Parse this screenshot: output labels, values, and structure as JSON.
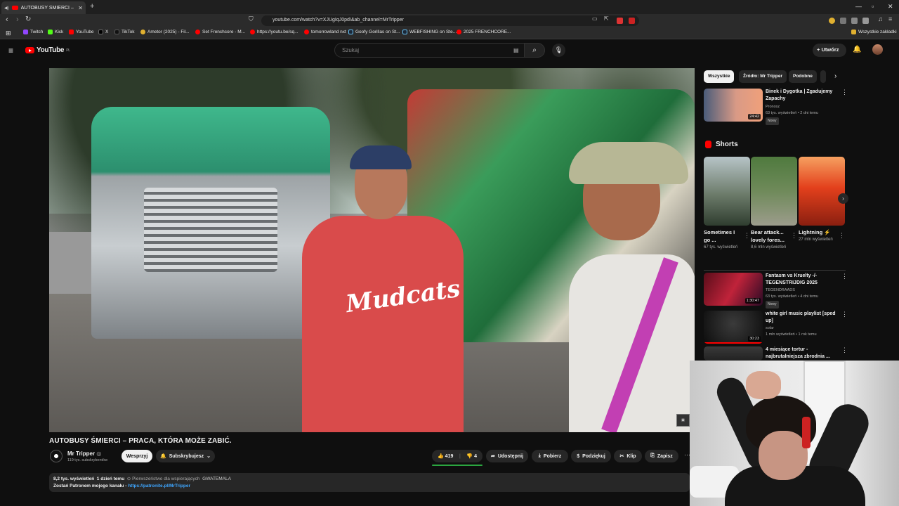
{
  "browser": {
    "tab_title": "AUTOBUSY ŚMIERCI – PRACA",
    "url": "youtube.com/watch?v=XJUgIqJ0pdI&ab_channel=MrTripper",
    "all_bookmarks": "Wszystkie zakładki",
    "bookmarks": [
      {
        "label": "Twitch",
        "color": "#9146ff"
      },
      {
        "label": "Kick",
        "color": "#53fc18"
      },
      {
        "label": "YouTube",
        "color": "#ff0000"
      },
      {
        "label": "X",
        "color": "#000000"
      },
      {
        "label": "TikTok",
        "color": "#111111"
      },
      {
        "label": "Ametor (2025) - Fil...",
        "color": "#e0b030"
      },
      {
        "label": "Set Frenchcore - M...",
        "color": "#ff0000"
      },
      {
        "label": "https://youtu.be/sq...",
        "color": "#ff0000"
      },
      {
        "label": "tomorrowland nxt",
        "color": "#ff0000"
      },
      {
        "label": "Goofy Gorillas on St...",
        "color": "#1b2838"
      },
      {
        "label": "WEBFISHING on Ste...",
        "color": "#1b2838"
      },
      {
        "label": "2025 FRENCHCORE...",
        "color": "#ff0000"
      }
    ]
  },
  "youtube": {
    "logo_text": "YouTube",
    "logo_region": "PL",
    "search_placeholder": "Szukaj",
    "create_label": "Utwórz"
  },
  "video": {
    "title": "AUTOBUSY ŚMIERCI – PRACA, KTÓRA MOŻE ZABIĆ.",
    "shirt_text": "Mudcats",
    "channel_name": "Mr Tripper",
    "channel_subs": "119 tys. subskrybentów",
    "support_label": "Wesprzyj",
    "subscribe_label": "Subskrybujesz",
    "likes": "419",
    "dislikes": "4",
    "actions": [
      "Udostępnij",
      "Pobierz",
      "Podziękuj",
      "Klip",
      "Zapisz"
    ],
    "views": "8,2 tys. wyświetleń",
    "age": "1 dzień temu",
    "priority": "Pierwszeństwo dla wspierających",
    "tag": "GWATEMALA",
    "desc_line": "Zostań Patronem mojego kanału - ",
    "desc_link": "https://patronite.pl/MrTripper"
  },
  "sidebar": {
    "chips": [
      "Wszystkie",
      "Źródło: Mr Tripper",
      "Podobne"
    ],
    "first": {
      "title": "Binek i Dygotka | Zgadujemy Zapachy",
      "channel": "Pronosz",
      "meta": "63 tys. wyświetleń • 2 dni temu",
      "badge": "Nowy",
      "duration": "24:42"
    },
    "shorts_heading": "Shorts",
    "shorts": [
      {
        "title": "Sometimes I go ...",
        "views": "67 tys. wyświetleń"
      },
      {
        "title": "Bear attack... lovely fores...",
        "views": "8,6 mln wyświetleń"
      },
      {
        "title": "Lightning ⚡",
        "views": "27 mln wyświetleń"
      }
    ],
    "items": [
      {
        "title": "Fantasm vs Kruelty -/- TEGENSTRIJDIG 2025",
        "channel": "TEGENDRAADS",
        "meta": "63 tys. wyświetleń • 4 dni temu",
        "badge": "Nowy",
        "duration": "1:30:47"
      },
      {
        "title": "white girl music playlist [sped up]",
        "channel": "solar",
        "meta": "1 mln wyświetleń • 1 rok temu",
        "badge": "",
        "duration": "30:23"
      },
      {
        "title": "4 miesiące tortur - najbrutalniejsza zbrodnia ...",
        "channel": "",
        "meta": "",
        "badge": "",
        "duration": ""
      }
    ]
  }
}
